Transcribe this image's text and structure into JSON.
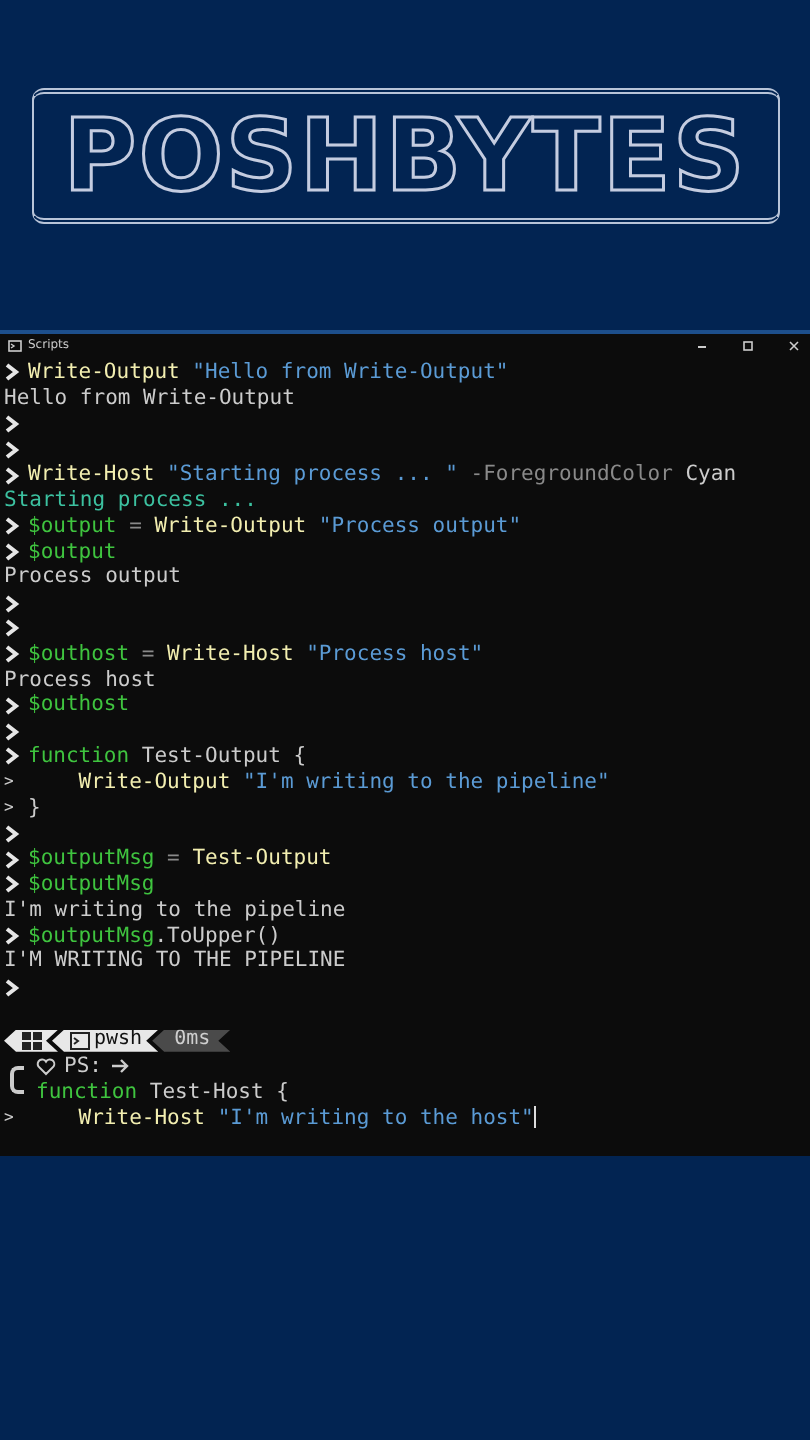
{
  "banner": {
    "logo": "POSHBYTES"
  },
  "window": {
    "title": "Scripts"
  },
  "lines": [
    {
      "kind": "command",
      "segments": [
        {
          "kind": "cmd",
          "text": "Write-Output"
        },
        {
          "kind": "str",
          "text": " \"Hello from Write-Output\""
        }
      ]
    },
    {
      "kind": "output",
      "segments": [
        {
          "kind": "out",
          "text": "Hello from Write-Output"
        }
      ]
    },
    {
      "kind": "command"
    },
    {
      "kind": "command"
    },
    {
      "kind": "command",
      "segments": [
        {
          "kind": "cmd",
          "text": "Write-Host"
        },
        {
          "kind": "str",
          "text": " \"Starting process ... \""
        },
        {
          "kind": "param",
          "text": " -ForegroundColor"
        },
        {
          "kind": "plain",
          "text": " Cyan"
        }
      ]
    },
    {
      "kind": "output",
      "segments": [
        {
          "kind": "cyan",
          "text": "Starting process ..."
        }
      ]
    },
    {
      "kind": "command",
      "segments": [
        {
          "kind": "var",
          "text": "$output"
        },
        {
          "kind": "param",
          "text": " = "
        },
        {
          "kind": "cmd",
          "text": "Write-Output"
        },
        {
          "kind": "str",
          "text": " \"Process output\""
        }
      ]
    },
    {
      "kind": "command",
      "segments": [
        {
          "kind": "var",
          "text": "$output"
        }
      ]
    },
    {
      "kind": "output",
      "segments": [
        {
          "kind": "out",
          "text": "Process output"
        }
      ]
    },
    {
      "kind": "command"
    },
    {
      "kind": "command"
    },
    {
      "kind": "command",
      "segments": [
        {
          "kind": "var",
          "text": "$outhost"
        },
        {
          "kind": "param",
          "text": " = "
        },
        {
          "kind": "cmd",
          "text": "Write-Host"
        },
        {
          "kind": "str",
          "text": " \"Process host\""
        }
      ]
    },
    {
      "kind": "output",
      "segments": [
        {
          "kind": "out",
          "text": "Process host"
        }
      ]
    },
    {
      "kind": "command",
      "segments": [
        {
          "kind": "var",
          "text": "$outhost"
        }
      ]
    },
    {
      "kind": "command"
    },
    {
      "kind": "command",
      "segments": [
        {
          "kind": "var",
          "text": "function"
        },
        {
          "kind": "out",
          "text": " Test-Output {"
        }
      ]
    },
    {
      "kind": "continuation",
      "marker": ">",
      "segments": [
        {
          "kind": "cmd",
          "text": "    Write-Output"
        },
        {
          "kind": "str",
          "text": " \"I'm writing to the pipeline\""
        }
      ]
    },
    {
      "kind": "continuation",
      "marker": ">",
      "segments": [
        {
          "kind": "out",
          "text": "}"
        }
      ]
    },
    {
      "kind": "command"
    },
    {
      "kind": "command",
      "segments": [
        {
          "kind": "var",
          "text": "$outputMsg"
        },
        {
          "kind": "param",
          "text": " = "
        },
        {
          "kind": "cmd",
          "text": "Test-Output"
        }
      ]
    },
    {
      "kind": "command",
      "segments": [
        {
          "kind": "var",
          "text": "$outputMsg"
        }
      ]
    },
    {
      "kind": "output",
      "segments": [
        {
          "kind": "out",
          "text": "I'm writing to the pipeline"
        }
      ]
    },
    {
      "kind": "command",
      "segments": [
        {
          "kind": "var",
          "text": "$outputMsg"
        },
        {
          "kind": "out",
          "text": ".ToUpper()"
        }
      ]
    },
    {
      "kind": "output",
      "segments": [
        {
          "kind": "out",
          "text": "I'M WRITING TO THE PIPELINE"
        }
      ]
    },
    {
      "kind": "command"
    }
  ],
  "status": {
    "shell": "pwsh",
    "duration": "0ms",
    "prompt_label": "PS:"
  },
  "input_lines": [
    {
      "kind": "input",
      "segments": [
        {
          "kind": "var",
          "text": "function"
        },
        {
          "kind": "out",
          "text": " Test-Host {"
        }
      ]
    },
    {
      "kind": "continuation",
      "marker": ">",
      "cursor": true,
      "segments": [
        {
          "kind": "cmd",
          "text": "    Write-Host"
        },
        {
          "kind": "str",
          "text": " \"I'm writing to the host\""
        }
      ]
    }
  ]
}
